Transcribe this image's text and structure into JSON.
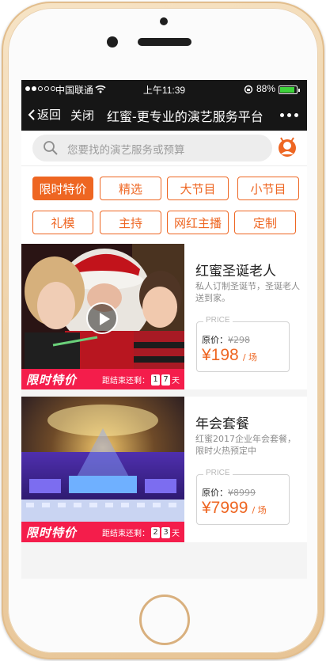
{
  "status_bar": {
    "carrier": "中国联通",
    "time": "上午11:39",
    "battery": "88%"
  },
  "nav": {
    "back_label": "返回",
    "close_label": "关闭",
    "title": "红蜜-更专业的演艺服务平台"
  },
  "search": {
    "placeholder": "您要找的演艺服务或预算"
  },
  "categories": [
    "限时特价",
    "精选",
    "大节目",
    "小节目",
    "礼模",
    "主持",
    "网红主播",
    "定制"
  ],
  "active_category": "限时特价",
  "colors": {
    "accent": "#ee6622",
    "sale_bar": "#f41d4b",
    "nav_bg": "#161616"
  },
  "products": [
    {
      "title": "红蜜圣诞老人",
      "description": "私人订制圣诞节，圣诞老人送到家。",
      "price_tag": "PRICE",
      "original_label": "原价：",
      "original_price": "¥298",
      "price": "¥198",
      "unit": "/ 场",
      "sale_label": "限时特价",
      "countdown_label": "距结束还剩：",
      "countdown_digits": [
        "1",
        "7"
      ],
      "countdown_unit": "天"
    },
    {
      "title": "年会套餐",
      "description": "红蜜2017企业年会套餐，限时火热预定中",
      "price_tag": "PRICE",
      "original_label": "原价：",
      "original_price": "¥8999",
      "price": "¥7999",
      "unit": "/ 场",
      "sale_label": "限时特价",
      "countdown_label": "距结束还剩：",
      "countdown_digits": [
        "2",
        "3"
      ],
      "countdown_unit": "天"
    }
  ]
}
